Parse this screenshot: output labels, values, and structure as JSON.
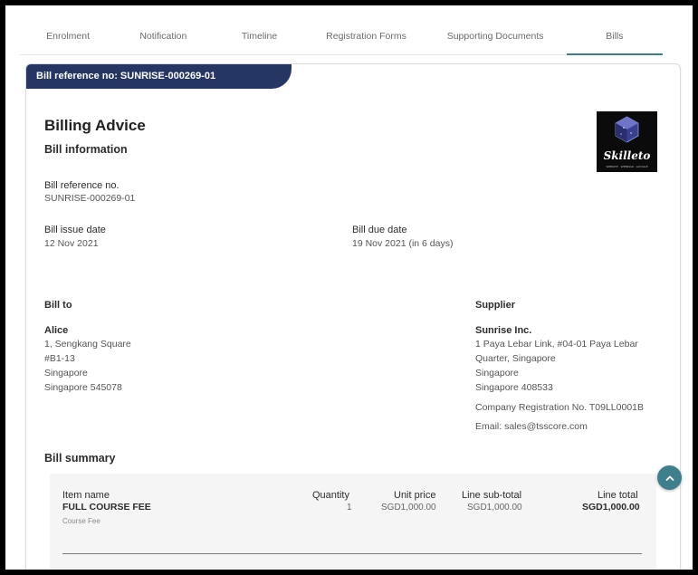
{
  "tabs": [
    {
      "label": "Enrolment",
      "active": false
    },
    {
      "label": "Notification",
      "active": false
    },
    {
      "label": "Timeline",
      "active": false
    },
    {
      "label": "Registration Forms",
      "active": false
    },
    {
      "label": "Supporting Documents",
      "active": false
    },
    {
      "label": "Bills",
      "active": true
    }
  ],
  "banner": "Bill reference no: SUNRISE-000269-01",
  "logo": {
    "text": "Skilleto",
    "tagline": "WEBSITE · WEBINAR · GOOGLE",
    "icon": "cube-logo"
  },
  "billing": {
    "title": "Billing Advice",
    "info_heading": "Bill information",
    "ref_label": "Bill reference no.",
    "ref_value": "SUNRISE-000269-01",
    "issue_label": "Bill issue date",
    "issue_value": "12 Nov 2021",
    "due_label": "Bill due date",
    "due_value": "19 Nov 2021 (in 6 days)"
  },
  "bill_to": {
    "heading": "Bill to",
    "name": "Alice",
    "lines": [
      "1, Sengkang Square",
      "#B1-13",
      "Singapore",
      "Singapore 545078"
    ]
  },
  "supplier": {
    "heading": "Supplier",
    "name": "Sunrise Inc.",
    "lines": [
      "1 Paya Lebar Link, #04-01 Paya Lebar",
      "Quarter, Singapore",
      "Singapore",
      "Singapore 408533"
    ],
    "reg": "Company Registration No. T09LL0001B",
    "email": "Email: sales@tsscore.com"
  },
  "summary": {
    "heading": "Bill summary",
    "headers": {
      "item": "Item name",
      "qty": "Quantity",
      "unit": "Unit price",
      "subtotal": "Line sub-total",
      "total": "Line total"
    },
    "row": {
      "item": "FULL COURSE FEE",
      "desc": "Course Fee",
      "qty": "1",
      "unit": "SGD1,000.00",
      "subtotal": "SGD1,000.00",
      "total": "SGD1,000.00"
    }
  },
  "colors": {
    "banner": "#253564",
    "accent": "#3e7f8c"
  }
}
